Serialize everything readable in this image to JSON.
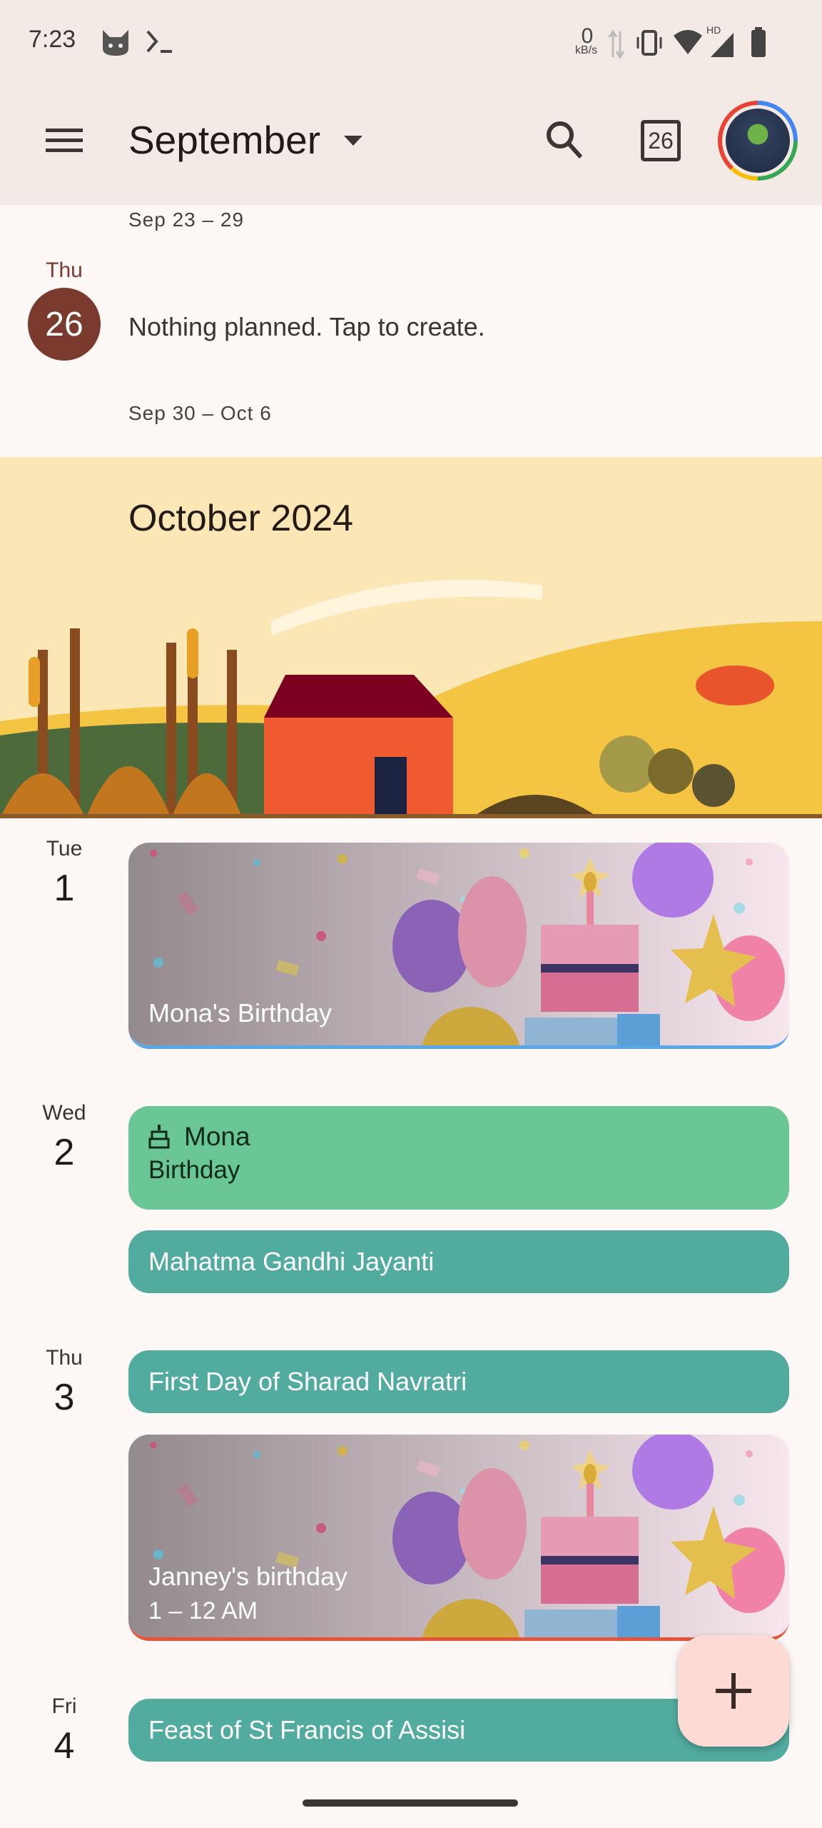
{
  "status_bar": {
    "time": "7:23",
    "net_speed": "0",
    "net_unit": "kB/s",
    "signal_label": "HD",
    "icons": [
      "cat-icon",
      "terminal-icon",
      "data-arrows-icon",
      "vibrate-icon",
      "wifi-icon",
      "signal-icon",
      "battery-icon"
    ]
  },
  "app_bar": {
    "title": "September",
    "today_date": "26",
    "icons": [
      "menu-icon",
      "dropdown-icon",
      "search-icon",
      "today-icon",
      "avatar"
    ]
  },
  "schedule": {
    "week1": "Sep 23 – 29",
    "today": {
      "dow": "Thu",
      "day": "26",
      "empty_text": "Nothing planned. Tap to create.",
      "color": "#7b3a2e"
    },
    "week2": "Sep 30 – Oct 6",
    "month_banner": "October 2024",
    "days": [
      {
        "dow": "Tue",
        "day": "1",
        "events": [
          {
            "title": "Mona's Birthday",
            "type": "birthday-banner",
            "accent": "#5aa7ea"
          }
        ]
      },
      {
        "dow": "Wed",
        "day": "2",
        "events": [
          {
            "title": "Mona",
            "subtitle": "Birthday",
            "color": "#6ac695",
            "icon": "cake-icon"
          },
          {
            "title": "Mahatma Gandhi Jayanti",
            "color": "#52ab9f"
          }
        ]
      },
      {
        "dow": "Thu",
        "day": "3",
        "events": [
          {
            "title": "First Day of Sharad Navratri",
            "color": "#52ab9f"
          },
          {
            "title": "Janney's birthday",
            "time": "1 – 12 AM",
            "type": "birthday-banner",
            "accent": "#e5533a"
          }
        ]
      },
      {
        "dow": "Fri",
        "day": "4",
        "events": [
          {
            "title": "Feast of St Francis of Assisi",
            "color": "#52ab9f"
          }
        ]
      }
    ]
  },
  "fab": {
    "icon": "plus-icon",
    "color": "#fddad3"
  }
}
